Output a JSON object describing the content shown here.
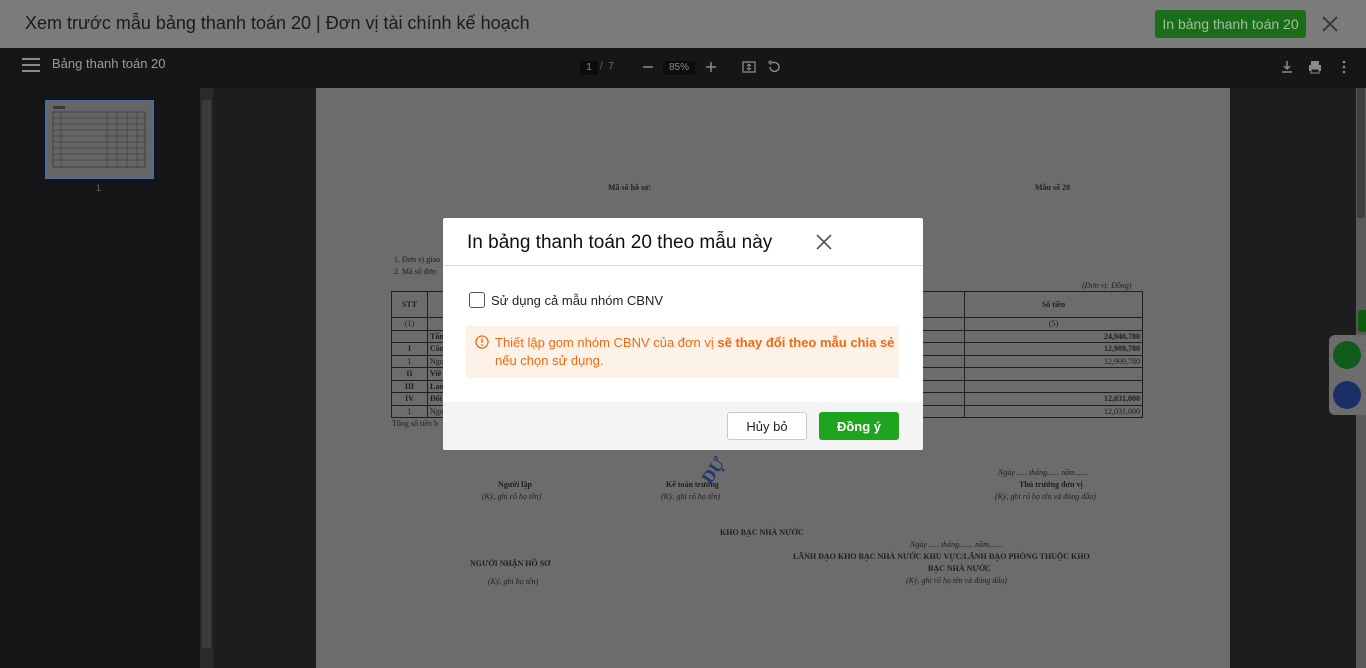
{
  "header": {
    "title": "Xem trước mẫu bảng thanh toán 20 | Đơn vị tài chính kế hoạch",
    "print_button": "In bảng thanh toán 20"
  },
  "pdf_toolbar": {
    "doc_title": "Bảng thanh toán 20",
    "current_page": "1",
    "page_separator": "/",
    "total_pages": "7",
    "zoom": "85%",
    "zoom_out": "−",
    "zoom_in": "+"
  },
  "thumbnail": {
    "page_label": "1"
  },
  "document": {
    "ma_so_ho_so": "Mã số hồ sơ:",
    "mau_so": "Mẫu số 20",
    "line1": "1. Đơn vị giao",
    "line2": "2. Mã số đơn",
    "unit": "(Đơn vị: Đồng)",
    "table_head": [
      "STT",
      "Số tiền"
    ],
    "table_rows": [
      [
        "(1)",
        "",
        "(5)"
      ],
      [
        "",
        "Tổn",
        "24,940,780"
      ],
      [
        "I",
        "Côn",
        "12,909,780"
      ],
      [
        "1",
        "Ngư",
        "12,909,780"
      ],
      [
        "II",
        "Viê",
        ""
      ],
      [
        "III",
        "Lao",
        ""
      ],
      [
        "IV",
        "Đối",
        "12,031,000"
      ],
      [
        "1",
        "Ngư",
        "12,031,000"
      ]
    ],
    "total_label": "Tổng số tiền b",
    "nguoi_lap": "Người lập",
    "ky_ghi_ro_ho_ten": "(Ký, ghi rõ họ tên)",
    "ke_toan_truong": "Kế toán trưởng",
    "ky_ghi_ro_ho_ten_2": "(Ký, ghi rõ họ tên)",
    "ngay_thang_nam_1": "Ngày ..... tháng...... năm.......",
    "thu_truong": "Thủ trưởng đơn vị",
    "ky_dong_dau": "(Ký, ghi rõ họ tên và đóng dấu)",
    "kho_bac": "KHO BẠC NHÀ NƯỚC",
    "ngay_thang_nam_2": "Ngày ..... tháng....... năm.......",
    "lanh_dao_1": "LÃNH ĐẠO KHO BẠC NHÀ NƯỚC KHU VỰC/LÃNH ĐẠO PHÒNG THUỘC KHO",
    "lanh_dao_2": "BẠC NHÀ NƯỚC",
    "ky_dong_dau_2": "(Ký, ghi rõ họ tên và đóng dấu)",
    "nguoi_nhan": "NGƯỜI NHẬN HỒ SƠ",
    "ky_ghi_ho_ten": "(Ký, ghi họ tên)",
    "watermark": "DỰ"
  },
  "modal": {
    "title": "In bảng thanh toán 20 theo mẫu này",
    "checkbox_label": "Sử dụng cả mẫu nhóm CBNV",
    "checkbox_checked": false,
    "warning_prefix": "Thiết lập gom nhóm CBNV của đơn vị ",
    "warning_bold": "sẽ thay đổi theo mẫu chia sẻ",
    "warning_suffix": " nếu chọn sử dụng.",
    "cancel_button": "Hủy bỏ",
    "ok_button": "Đồng ý"
  },
  "colors": {
    "primary_green": "#1fa41f",
    "warning_orange": "#ee6a17",
    "warning_bg": "#fdf2e7"
  }
}
